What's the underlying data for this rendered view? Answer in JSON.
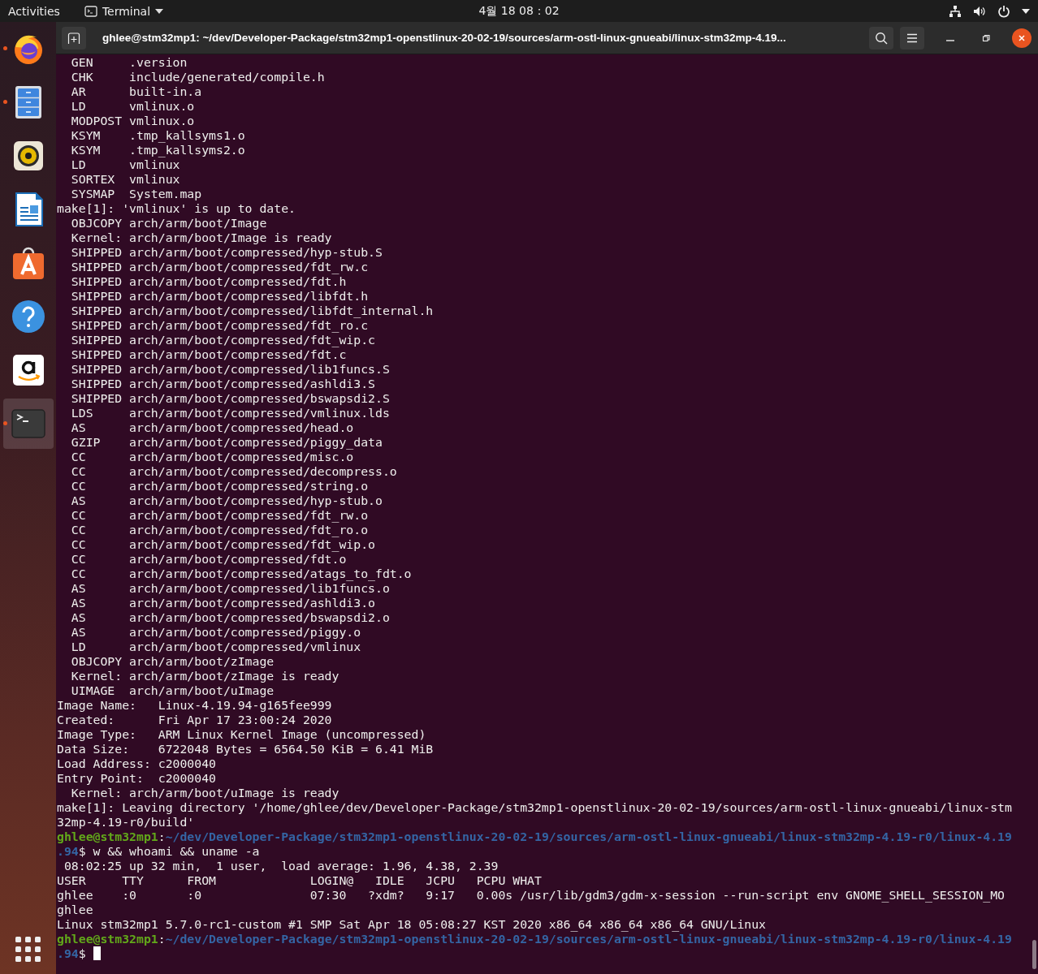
{
  "top_bar": {
    "activities": "Activities",
    "app_menu": "Terminal",
    "clock": "4월 18  08：02"
  },
  "dock": {
    "items": [
      {
        "kind": "browser",
        "running": true,
        "selected": false
      },
      {
        "kind": "files",
        "running": true,
        "selected": false
      },
      {
        "kind": "music",
        "running": false,
        "selected": false
      },
      {
        "kind": "writer",
        "running": false,
        "selected": false
      },
      {
        "kind": "software",
        "running": false,
        "selected": false
      },
      {
        "kind": "help",
        "running": false,
        "selected": false
      },
      {
        "kind": "shop",
        "running": false,
        "selected": false
      },
      {
        "kind": "terminal",
        "running": true,
        "selected": true
      }
    ]
  },
  "window": {
    "title": "ghlee@stm32mp1: ~/dev/Developer-Package/stm32mp1-openstlinux-20-02-19/sources/arm-ostl-linux-gnueabi/linux-stm32mp-4.19..."
  },
  "terminal": {
    "lines": [
      {
        "kind": "output",
        "text": "  GEN     .version"
      },
      {
        "kind": "output",
        "text": "  CHK     include/generated/compile.h"
      },
      {
        "kind": "output",
        "text": "  AR      built-in.a"
      },
      {
        "kind": "output",
        "text": "  LD      vmlinux.o"
      },
      {
        "kind": "output",
        "text": "  MODPOST vmlinux.o"
      },
      {
        "kind": "output",
        "text": "  KSYM    .tmp_kallsyms1.o"
      },
      {
        "kind": "output",
        "text": "  KSYM    .tmp_kallsyms2.o"
      },
      {
        "kind": "output",
        "text": "  LD      vmlinux"
      },
      {
        "kind": "output",
        "text": "  SORTEX  vmlinux"
      },
      {
        "kind": "output",
        "text": "  SYSMAP  System.map"
      },
      {
        "kind": "output",
        "text": "make[1]: 'vmlinux' is up to date."
      },
      {
        "kind": "output",
        "text": "  OBJCOPY arch/arm/boot/Image"
      },
      {
        "kind": "output",
        "text": "  Kernel: arch/arm/boot/Image is ready"
      },
      {
        "kind": "output",
        "text": "  SHIPPED arch/arm/boot/compressed/hyp-stub.S"
      },
      {
        "kind": "output",
        "text": "  SHIPPED arch/arm/boot/compressed/fdt_rw.c"
      },
      {
        "kind": "output",
        "text": "  SHIPPED arch/arm/boot/compressed/fdt.h"
      },
      {
        "kind": "output",
        "text": "  SHIPPED arch/arm/boot/compressed/libfdt.h"
      },
      {
        "kind": "output",
        "text": "  SHIPPED arch/arm/boot/compressed/libfdt_internal.h"
      },
      {
        "kind": "output",
        "text": "  SHIPPED arch/arm/boot/compressed/fdt_ro.c"
      },
      {
        "kind": "output",
        "text": "  SHIPPED arch/arm/boot/compressed/fdt_wip.c"
      },
      {
        "kind": "output",
        "text": "  SHIPPED arch/arm/boot/compressed/fdt.c"
      },
      {
        "kind": "output",
        "text": "  SHIPPED arch/arm/boot/compressed/lib1funcs.S"
      },
      {
        "kind": "output",
        "text": "  SHIPPED arch/arm/boot/compressed/ashldi3.S"
      },
      {
        "kind": "output",
        "text": "  SHIPPED arch/arm/boot/compressed/bswapsdi2.S"
      },
      {
        "kind": "output",
        "text": "  LDS     arch/arm/boot/compressed/vmlinux.lds"
      },
      {
        "kind": "output",
        "text": "  AS      arch/arm/boot/compressed/head.o"
      },
      {
        "kind": "output",
        "text": "  GZIP    arch/arm/boot/compressed/piggy_data"
      },
      {
        "kind": "output",
        "text": "  CC      arch/arm/boot/compressed/misc.o"
      },
      {
        "kind": "output",
        "text": "  CC      arch/arm/boot/compressed/decompress.o"
      },
      {
        "kind": "output",
        "text": "  CC      arch/arm/boot/compressed/string.o"
      },
      {
        "kind": "output",
        "text": "  AS      arch/arm/boot/compressed/hyp-stub.o"
      },
      {
        "kind": "output",
        "text": "  CC      arch/arm/boot/compressed/fdt_rw.o"
      },
      {
        "kind": "output",
        "text": "  CC      arch/arm/boot/compressed/fdt_ro.o"
      },
      {
        "kind": "output",
        "text": "  CC      arch/arm/boot/compressed/fdt_wip.o"
      },
      {
        "kind": "output",
        "text": "  CC      arch/arm/boot/compressed/fdt.o"
      },
      {
        "kind": "output",
        "text": "  CC      arch/arm/boot/compressed/atags_to_fdt.o"
      },
      {
        "kind": "output",
        "text": "  AS      arch/arm/boot/compressed/lib1funcs.o"
      },
      {
        "kind": "output",
        "text": "  AS      arch/arm/boot/compressed/ashldi3.o"
      },
      {
        "kind": "output",
        "text": "  AS      arch/arm/boot/compressed/bswapsdi2.o"
      },
      {
        "kind": "output",
        "text": "  AS      arch/arm/boot/compressed/piggy.o"
      },
      {
        "kind": "output",
        "text": "  LD      arch/arm/boot/compressed/vmlinux"
      },
      {
        "kind": "output",
        "text": "  OBJCOPY arch/arm/boot/zImage"
      },
      {
        "kind": "output",
        "text": "  Kernel: arch/arm/boot/zImage is ready"
      },
      {
        "kind": "output",
        "text": "  UIMAGE  arch/arm/boot/uImage"
      },
      {
        "kind": "output",
        "text": "Image Name:   Linux-4.19.94-g165fee999"
      },
      {
        "kind": "output",
        "text": "Created:      Fri Apr 17 23:00:24 2020"
      },
      {
        "kind": "output",
        "text": "Image Type:   ARM Linux Kernel Image (uncompressed)"
      },
      {
        "kind": "output",
        "text": "Data Size:    6722048 Bytes = 6564.50 KiB = 6.41 MiB"
      },
      {
        "kind": "output",
        "text": "Load Address: c2000040"
      },
      {
        "kind": "output",
        "text": "Entry Point:  c2000040"
      },
      {
        "kind": "output",
        "text": "  Kernel: arch/arm/boot/uImage is ready"
      },
      {
        "kind": "output",
        "text": "make[1]: Leaving directory '/home/ghlee/dev/Developer-Package/stm32mp1-openstlinux-20-02-19/sources/arm-ostl-linux-gnueabi/linux-stm"
      },
      {
        "kind": "output",
        "text": "32mp-4.19-r0/build'"
      },
      {
        "kind": "prompt",
        "user": "ghlee@stm32mp1",
        "sep": ":",
        "path": "~/dev/Developer-Package/stm32mp1-openstlinux-20-02-19/sources/arm-ostl-linux-gnueabi/linux-stm32mp-4.19-r0/linux-4.19"
      },
      {
        "kind": "prompt_end",
        "path": ".94",
        "command": "$ w && whoami && uname -a",
        "cursor": false
      },
      {
        "kind": "output",
        "text": " 08:02:25 up 32 min,  1 user,  load average: 1.96, 4.38, 2.39"
      },
      {
        "kind": "output",
        "text": "USER     TTY      FROM             LOGIN@   IDLE   JCPU   PCPU WHAT"
      },
      {
        "kind": "output",
        "text": "ghlee    :0       :0               07:30   ?xdm?   9:17   0.00s /usr/lib/gdm3/gdm-x-session --run-script env GNOME_SHELL_SESSION_MO"
      },
      {
        "kind": "output",
        "text": "ghlee"
      },
      {
        "kind": "output",
        "text": "Linux stm32mp1 5.7.0-rc1-custom #1 SMP Sat Apr 18 05:08:27 KST 2020 x86_64 x86_64 x86_64 GNU/Linux"
      },
      {
        "kind": "prompt",
        "user": "ghlee@stm32mp1",
        "sep": ":",
        "path": "~/dev/Developer-Package/stm32mp1-openstlinux-20-02-19/sources/arm-ostl-linux-gnueabi/linux-stm32mp-4.19-r0/linux-4.19"
      },
      {
        "kind": "prompt_end",
        "path": ".94",
        "command": "$",
        "cursor": true
      }
    ]
  }
}
